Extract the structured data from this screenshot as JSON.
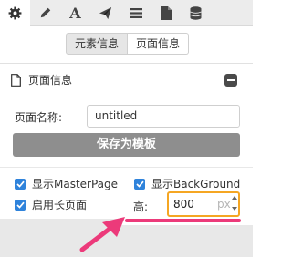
{
  "toolbar": {
    "icons": [
      "gear-icon",
      "pencil-icon",
      "text-icon",
      "send-icon",
      "menu-icon",
      "document-icon",
      "database-icon"
    ],
    "text_icon_glyph": "A"
  },
  "tabs": {
    "element_info": "元素信息",
    "page_info": "页面信息",
    "active": "page_info"
  },
  "section": {
    "title": "页面信息",
    "icon": "file-icon"
  },
  "form": {
    "page_name_label": "页面名称:",
    "page_name_value": "untitled",
    "save_template_label": "保存为模板"
  },
  "options": {
    "show_master_page": {
      "label": "显示MasterPage",
      "checked": true
    },
    "show_background": {
      "label": "显示BackGround",
      "checked": true
    },
    "long_page": {
      "label": "启用长页面",
      "checked": true
    },
    "height_label": "高:",
    "height_value": "800",
    "height_unit": "px"
  },
  "colors": {
    "accent": "#2f83db",
    "highlight": "#f5a623",
    "annotation": "#ec3a7a"
  }
}
